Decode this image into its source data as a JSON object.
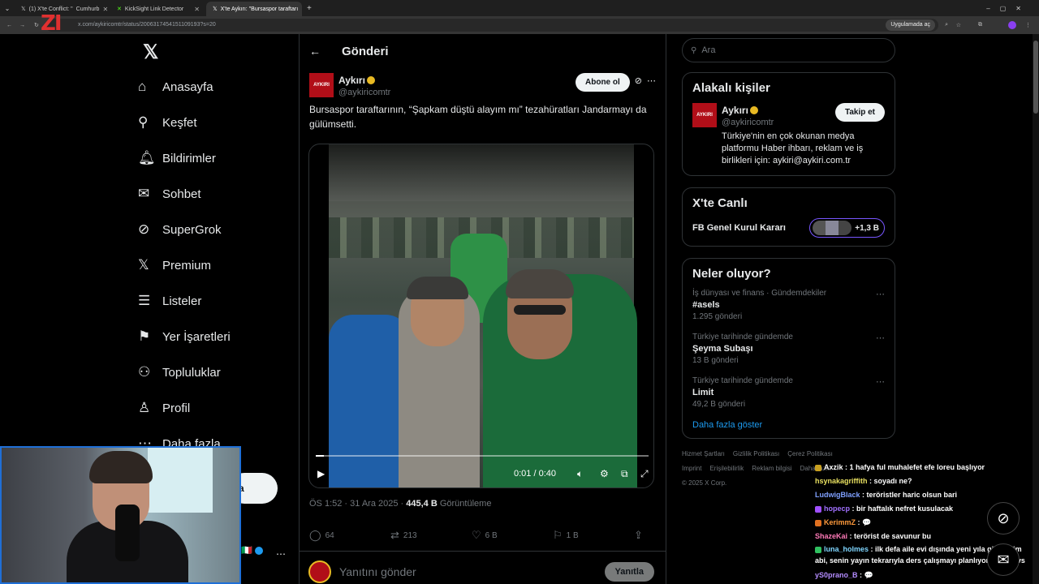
{
  "browser": {
    "tabs": [
      {
        "label": "(1) X'te Conflict: \"",
        "extra": "Cumhurb"
      },
      {
        "label": "KickSight Link Detector"
      },
      {
        "label": "X'te Aykırı: \"Bursaspor taraftarı"
      }
    ],
    "url": "x.com/aykiricomtr/status/2006317454151109193?s=20",
    "open_in_app": "Uygulamada aç",
    "overlay_logo": "ZI"
  },
  "nav": {
    "items": [
      {
        "label": "Anasayfa",
        "icon": "home-icon"
      },
      {
        "label": "Keşfet",
        "icon": "search-icon"
      },
      {
        "label": "Bildirimler",
        "icon": "bell-icon"
      },
      {
        "label": "Sohbet",
        "icon": "mail-icon"
      },
      {
        "label": "SuperGrok",
        "icon": "grok-icon"
      },
      {
        "label": "Premium",
        "icon": "x-icon"
      },
      {
        "label": "Listeler",
        "icon": "list-icon"
      },
      {
        "label": "Yer İşaretleri",
        "icon": "bookmark-icon"
      },
      {
        "label": "Topluluklar",
        "icon": "people-icon"
      },
      {
        "label": "Profil",
        "icon": "person-icon"
      },
      {
        "label": "Daha fazla",
        "icon": "more-circle-icon"
      }
    ],
    "post_button_partial": "a"
  },
  "post": {
    "header_title": "Gönderi",
    "author_name": "Aykırı",
    "author_handle": "@aykiricomtr",
    "avatar_text": "AYKIRI",
    "follow_label": "Abone ol",
    "text": "Bursaspor taraftarının, “Şapkam düştü alayım mı” tezahüratları Jandarmayı da gülümsetti.",
    "video": {
      "time": "0:01 / 0:40",
      "progress": 0.025
    },
    "meta_time": "ÖS 1:52 · 31 Ara 2025 · ",
    "views": "445,4 B",
    "views_label": "Görüntüleme",
    "stats": {
      "replies": "64",
      "reposts": "213",
      "likes": "6 B",
      "bookmarks": "1 B"
    },
    "reply_placeholder": "Yanıtını gönder",
    "reply_button": "Yanıtla"
  },
  "sidebar": {
    "search_placeholder": "Ara",
    "related": {
      "title": "Alakalı kişiler",
      "name": "Aykırı",
      "handle": "@aykiricomtr",
      "button": "Takip et",
      "bio": "Türkiye'nin en çok okunan medya platformu Haber ihbarı, reklam ve iş birlikleri için: aykiri@aykiri.com.tr"
    },
    "live": {
      "title": "X'te Canlı",
      "event": "FB Genel Kurul Kararı",
      "count": "+1,3 B"
    },
    "trends": {
      "title": "Neler oluyor?",
      "items": [
        {
          "category": "İş dünyası ve finans · Gündemdekiler",
          "title": "#asels",
          "count": "1.295 gönderi"
        },
        {
          "category": "Türkiye tarihinde gündemde",
          "title": "Şeyma Subaşı",
          "count": "13 B gönderi"
        },
        {
          "category": "Türkiye tarihinde gündemde",
          "title": "Limit",
          "count": "49,2 B gönderi"
        }
      ],
      "more": "Daha fazla göster"
    },
    "footer": {
      "row1": [
        "Hizmet Şartları",
        "Gizlilik Politikası",
        "Çerez Politikası"
      ],
      "row2": [
        "Imprint",
        "Erişilebilirlik",
        "Reklam bilgisi",
        "Daha fazla ..."
      ],
      "copyright": "© 2025 X Corp."
    }
  },
  "chat": [
    {
      "user": "Axzik",
      "text": "1 hafya ful muhalefet efe loreu başlıyor",
      "color": "#ffffff",
      "badge": "#c8a020"
    },
    {
      "user": "hsynakagriffith",
      "text": "soyadı ne?",
      "color": "#e8e060",
      "badge": ""
    },
    {
      "user": "LudwigBlack",
      "text": "teröristler haric olsun bari",
      "color": "#7fa0ff",
      "badge": ""
    },
    {
      "user": "hopecp",
      "text": "bir haftalık nefret kusulacak",
      "color": "#a070ff",
      "badge": "#a050ff"
    },
    {
      "user": "KerimmZ",
      "text": "💬",
      "color": "#ff9a3c",
      "badge": "#e07020"
    },
    {
      "user": "ShazeKai",
      "text": "terörist de savunur bu",
      "color": "#ff7ab8",
      "badge": ""
    },
    {
      "user": "luna_holmes",
      "text": "ilk defa aile evi dışında yeni yıla gireceğim abi, senin yayın tekrarıyla ders çalışmayı planlıyorum @cavs",
      "color": "#7fd6ff",
      "badge": "#30c060"
    },
    {
      "user": "yS0prano_B",
      "text": "💬",
      "color": "#b48cff",
      "badge": ""
    }
  ],
  "colors": {
    "accent": "#1d9bf0",
    "verified_gold": "#e8b923",
    "brand_red": "#b10e18",
    "live_purple": "#7856ff"
  }
}
